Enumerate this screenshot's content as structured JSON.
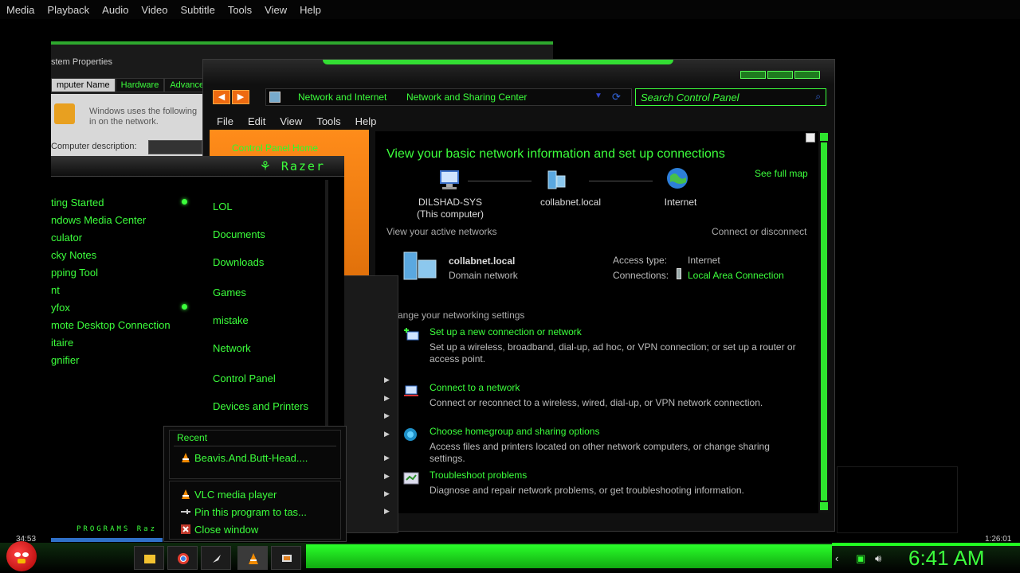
{
  "vlc": {
    "menu": [
      "Media",
      "Playback",
      "Audio",
      "Video",
      "Subtitle",
      "Tools",
      "View",
      "Help"
    ],
    "time_elapsed": "34:53",
    "time_total": "1:26:01"
  },
  "sysprops": {
    "title": "stem Properties",
    "tabs": [
      "mputer Name",
      "Hardware",
      "Advanced"
    ],
    "panel_text": "Windows uses the following in on the network.",
    "description_label": "Computer description:"
  },
  "explorer": {
    "address": [
      "Network and Internet",
      "Network and Sharing Center"
    ],
    "search_placeholder": "Search Control Panel",
    "menu": [
      "File",
      "Edit",
      "View",
      "Tools",
      "Help"
    ],
    "left_pane_link": "Control Panel Home",
    "title": "View your basic network information and set up connections",
    "see_full_map": "See full map",
    "nodes": [
      {
        "label": "DILSHAD-SYS",
        "sub": "(This computer)"
      },
      {
        "label": "collabnet.local",
        "sub": ""
      },
      {
        "label": "Internet",
        "sub": ""
      }
    ],
    "active_networks_label": "View your active networks",
    "connect_disconnect": "Connect or disconnect",
    "network_name": "collabnet.local",
    "network_type": "Domain network",
    "access_type_label": "Access type:",
    "access_type_value": "Internet",
    "connections_label": "Connections:",
    "connections_value": "Local Area Connection",
    "change_settings_label": "ange your networking settings",
    "tasks": [
      {
        "title": "Set up a new connection or network",
        "desc": "Set up a wireless, broadband, dial-up, ad hoc, or VPN connection; or set up a router or access point."
      },
      {
        "title": "Connect to a network",
        "desc": "Connect or reconnect to a wireless, wired, dial-up, or VPN network connection."
      },
      {
        "title": "Choose homegroup and sharing options",
        "desc": "Access files and printers located on other network computers, or change sharing settings."
      },
      {
        "title": "Troubleshoot problems",
        "desc": "Diagnose and repair network problems, or get troubleshooting information."
      }
    ]
  },
  "startmenu": {
    "brand": "Razer",
    "programs": [
      "ting Started",
      "ndows Media Center",
      "culator",
      "cky Notes",
      "pping Tool",
      "nt",
      "yfox",
      "mote Desktop Connection",
      "itaire",
      "gnifier"
    ],
    "right_links": [
      "LOL",
      "Documents",
      "Downloads",
      "Games",
      "mistake",
      "Network",
      "Control Panel",
      "Devices and Printers"
    ],
    "programs_strip": "PROGRAMS Raz"
  },
  "jumplist": {
    "recent_label": "Recent",
    "recent_item": "Beavis.And.Butt-Head....",
    "tasks": [
      "VLC media player",
      "Pin this program to tas...",
      "Close window"
    ]
  },
  "taskbar": {
    "clock": "6:41 AM",
    "accent": "#33ff33"
  }
}
